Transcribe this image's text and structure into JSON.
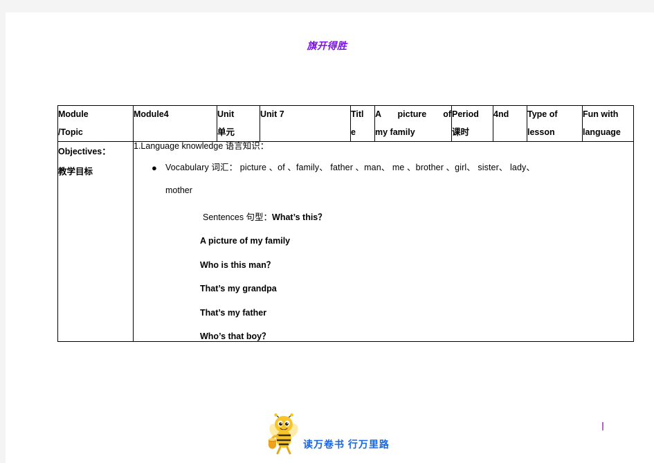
{
  "document": {
    "heading": "旗开得胜"
  },
  "table": {
    "header": {
      "module_topic": {
        "line1": "Module",
        "line2": "/Topic"
      },
      "module_value": "Module4",
      "unit_label": {
        "line1": "Unit",
        "line2": "单元"
      },
      "unit_value": "Unit 7",
      "title_label": {
        "line1": "Titl",
        "line2": "e"
      },
      "title_value": {
        "line1": "A picture of",
        "line2": "my family"
      },
      "period_label": {
        "line1": "Period",
        "line2": "课时"
      },
      "period_value": "4nd",
      "type_label": {
        "line1": "Type of",
        "line2": "lesson"
      },
      "type_value": {
        "line1": "Fun with",
        "line2": "language"
      }
    },
    "objectives": {
      "label_en": "Objectives：",
      "label_zh": "教学目标",
      "language_knowledge_title": "1.Language knowledge 语言知识：",
      "vocabulary_bullet": "●",
      "vocabulary_line1": "Vocabulary 词汇： picture 、of 、family、 father 、man、 me 、brother 、girl、 sister、 lady、",
      "vocabulary_line2": "mother",
      "sentences_label": "Sentences 句型：",
      "sentences_first": "What’s this？",
      "sentences": [
        "A picture of my family",
        "Who is this man？",
        "That’s my grandpa",
        "That’s my father",
        "Who’s that boy？"
      ]
    }
  },
  "footer": {
    "motto": "读万卷书 行万里路",
    "bee_icon": "bee-mascot-icon"
  },
  "colors": {
    "heading": "#7b11e8",
    "footer_text": "#1667e8",
    "border": "#000000",
    "page_background": "#ffffff",
    "canvas_background": "#f4f4f4"
  }
}
